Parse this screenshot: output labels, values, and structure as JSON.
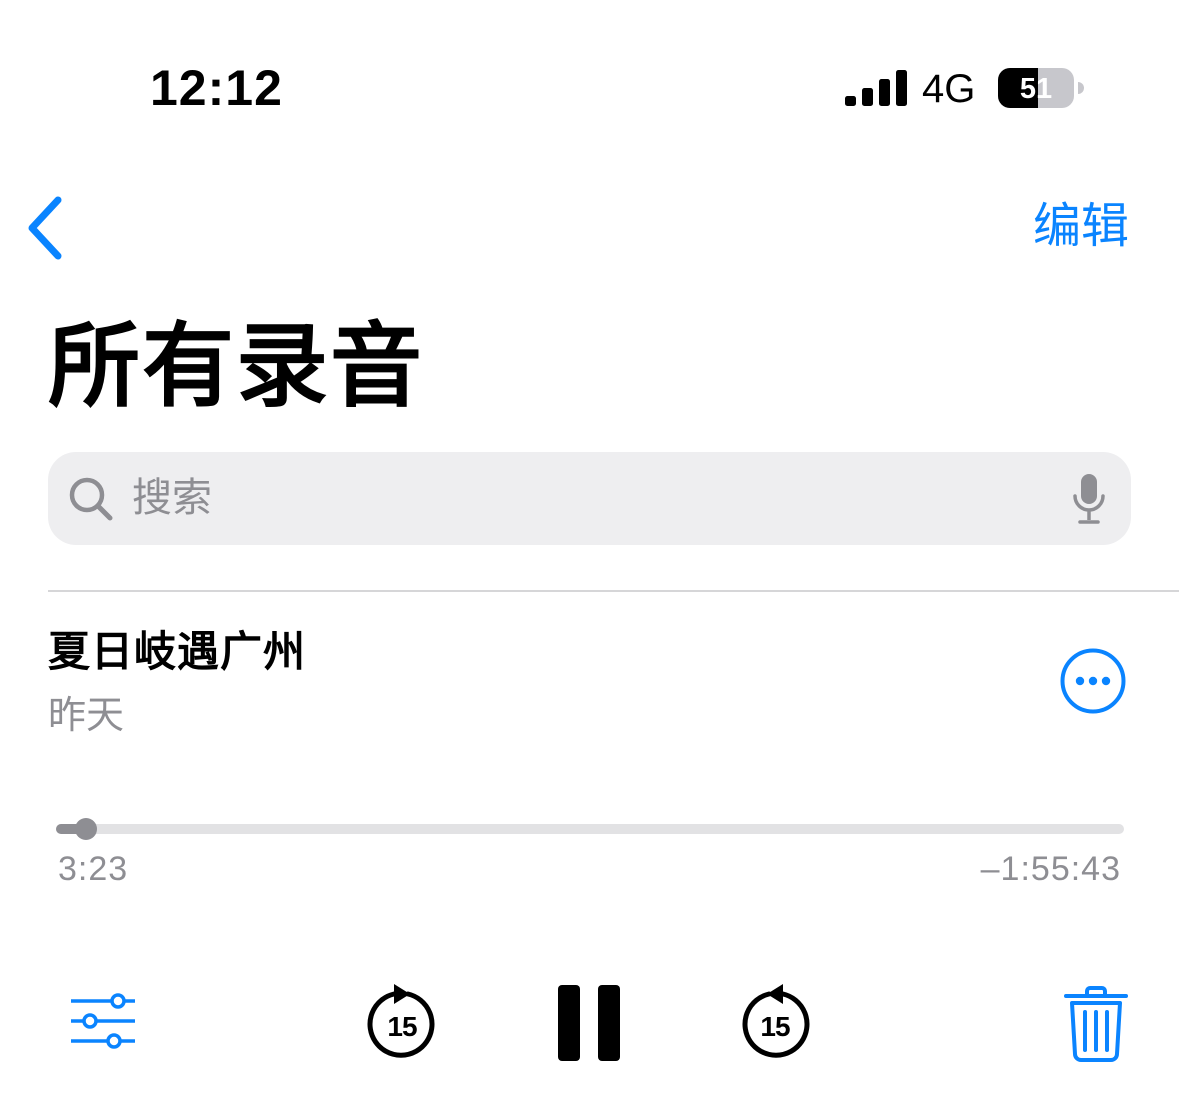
{
  "status_bar": {
    "time": "12:12",
    "network": "4G",
    "battery_level": "51"
  },
  "nav": {
    "edit_label": "编辑"
  },
  "title": "所有录音",
  "search": {
    "placeholder": "搜索"
  },
  "recording": {
    "title": "夏日岐遇广州",
    "date": "昨天",
    "elapsed": "3:23",
    "remaining": "–1:55:43",
    "progress_fraction": 0.028
  },
  "controls": {
    "skip_back_seconds": "15",
    "skip_forward_seconds": "15"
  },
  "colors": {
    "accent": "#0A84FF",
    "secondary_text": "#8E8E93"
  }
}
